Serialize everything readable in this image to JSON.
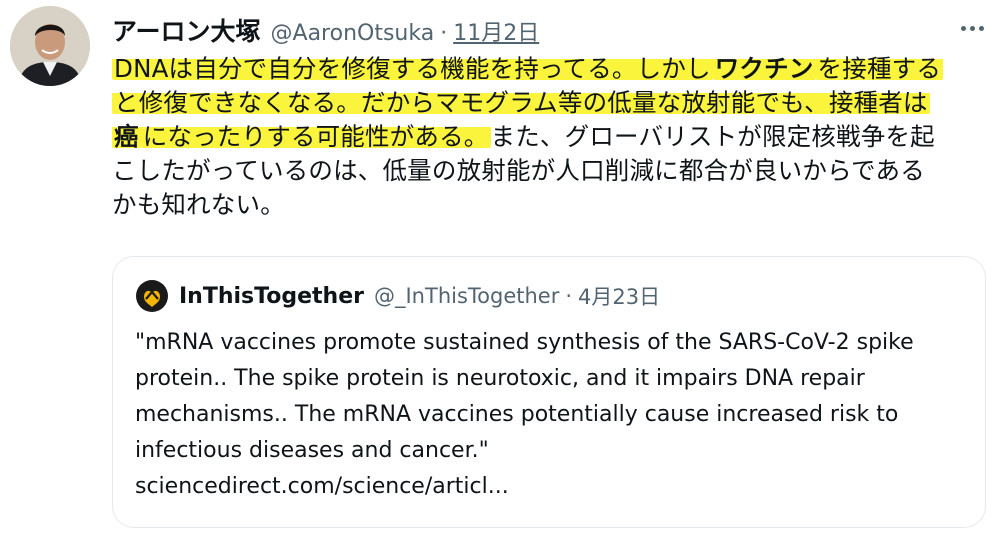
{
  "tweet": {
    "display_name": "アーロン大塚",
    "handle": "@AaronOtsuka",
    "separator": "·",
    "date": "11月2日",
    "body_lines": [
      [
        {
          "text": "DNAは自分で自分を修復する機能を持ってる。しかし",
          "hl": true
        },
        {
          "text": "ワクチン",
          "hl": true,
          "bold": true
        },
        {
          "text": "を接種する",
          "hl": true
        }
      ],
      [
        {
          "text": "と修復できなくなる。だからマモグラム等の低量な放射能でも、接種者は",
          "hl": true
        }
      ],
      [
        {
          "text": "癌",
          "hl": true,
          "bold": true
        },
        {
          "text": "になったりする可能性がある。",
          "hl": true
        },
        {
          "text": "また、グローバリストが限定核戦争を起",
          "hl": false
        }
      ],
      [
        {
          "text": "こしたがっているのは、低量の放射能が人口削減に都合が良いからである",
          "hl": false
        }
      ],
      [
        {
          "text": "かも知れない。",
          "hl": false
        }
      ]
    ]
  },
  "quote": {
    "name": "InThisTogether",
    "handle": "@_InThisTogether",
    "separator": "·",
    "date": "4月23日",
    "text_lines": [
      "\"mRNA vaccines promote sustained synthesis of the SARS-CoV-2 spike",
      "protein.. The spike protein is neurotoxic, and it impairs DNA repair",
      "mechanisms.. The mRNA vaccines potentially cause increased risk to",
      "infectious diseases and cancer.\""
    ],
    "link": "sciencedirect.com/science/articl..."
  },
  "icons": {
    "more": "more-dots-icon",
    "avatar": "profile-photo",
    "quote_avatar": "heart-hands-logo-icon"
  },
  "colors": {
    "highlight": "#fbf43c",
    "muted_text": "#536471",
    "text": "#0f1419",
    "border": "#e6e9ec"
  }
}
